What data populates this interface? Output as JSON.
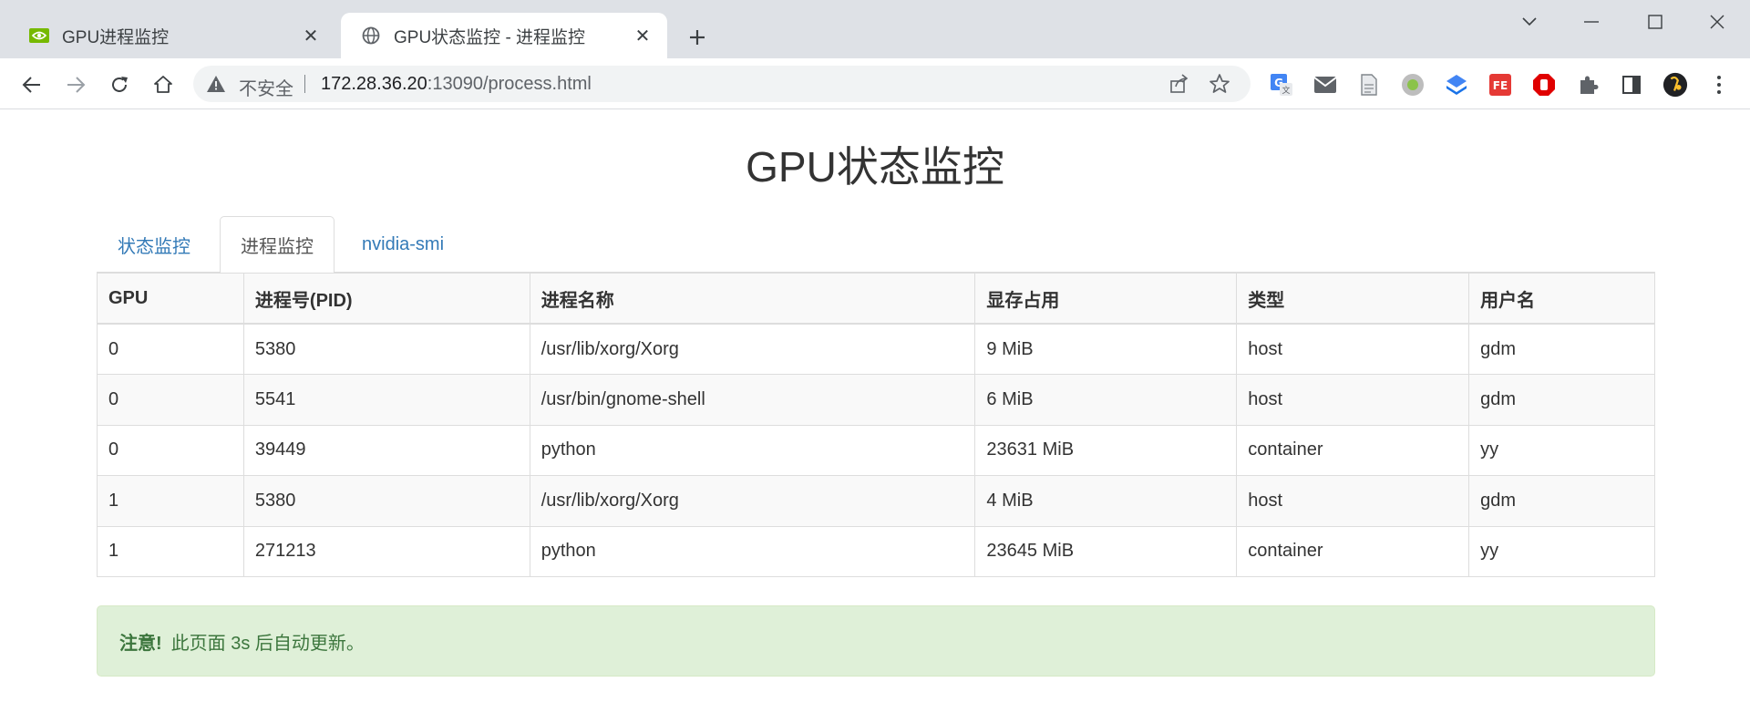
{
  "browser": {
    "tabs": [
      {
        "title": "GPU进程监控",
        "active": false,
        "favicon": "nvidia-icon"
      },
      {
        "title": "GPU状态监控 - 进程监控",
        "active": true,
        "favicon": "globe-icon"
      }
    ],
    "omnibox": {
      "security_label": "不安全",
      "url_host": "172.28.36.20",
      "url_path": ":13090/process.html"
    }
  },
  "page": {
    "title": "GPU状态监控",
    "nav_tabs": [
      {
        "label": "状态监控",
        "active": false
      },
      {
        "label": "进程监控",
        "active": true
      },
      {
        "label": "nvidia-smi",
        "active": false
      }
    ],
    "table": {
      "columns": [
        "GPU",
        "进程号(PID)",
        "进程名称",
        "显存占用",
        "类型",
        "用户名"
      ],
      "rows": [
        [
          "0",
          "5380",
          "/usr/lib/xorg/Xorg",
          "9 MiB",
          "host",
          "gdm"
        ],
        [
          "0",
          "5541",
          "/usr/bin/gnome-shell",
          "6 MiB",
          "host",
          "gdm"
        ],
        [
          "0",
          "39449",
          "python",
          "23631 MiB",
          "container",
          "yy"
        ],
        [
          "1",
          "5380",
          "/usr/lib/xorg/Xorg",
          "4 MiB",
          "host",
          "gdm"
        ],
        [
          "1",
          "271213",
          "python",
          "23645 MiB",
          "container",
          "yy"
        ]
      ]
    },
    "alert": {
      "title": "注意!",
      "message": "此页面 3s 后自动更新。"
    }
  },
  "colors": {
    "link": "#337ab7",
    "alert_bg": "#dff0d8",
    "alert_text": "#3c763d",
    "tabstrip_bg": "#dee1e6"
  }
}
